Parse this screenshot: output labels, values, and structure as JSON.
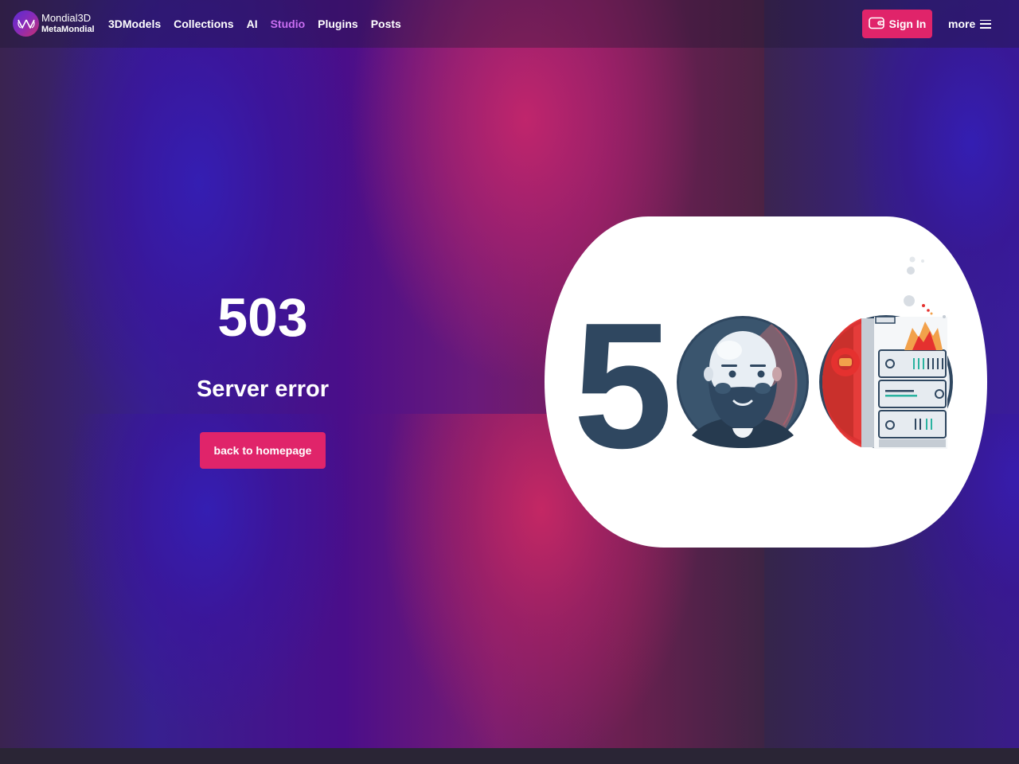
{
  "header": {
    "logo": {
      "name": "Mondial3D",
      "subtitle": "MetaMondial"
    },
    "nav": [
      {
        "label": "3DModels",
        "active": false
      },
      {
        "label": "Collections",
        "active": false
      },
      {
        "label": "AI",
        "active": false
      },
      {
        "label": "Studio",
        "active": true
      },
      {
        "label": "Plugins",
        "active": false
      },
      {
        "label": "Posts",
        "active": false
      }
    ],
    "sign_in_label": "Sign In",
    "more_label": "more"
  },
  "error": {
    "code": "503",
    "message": "Server error",
    "button_label": "back to homepage"
  },
  "illustration": {
    "digit": "5",
    "icons": [
      "bearded-man-icon",
      "server-rack-on-fire-icon"
    ]
  },
  "colors": {
    "accent": "#e0246a",
    "nav_active": "#c96ef2",
    "illustration_dark": "#2f4760",
    "illustration_red": "#e5312f"
  }
}
